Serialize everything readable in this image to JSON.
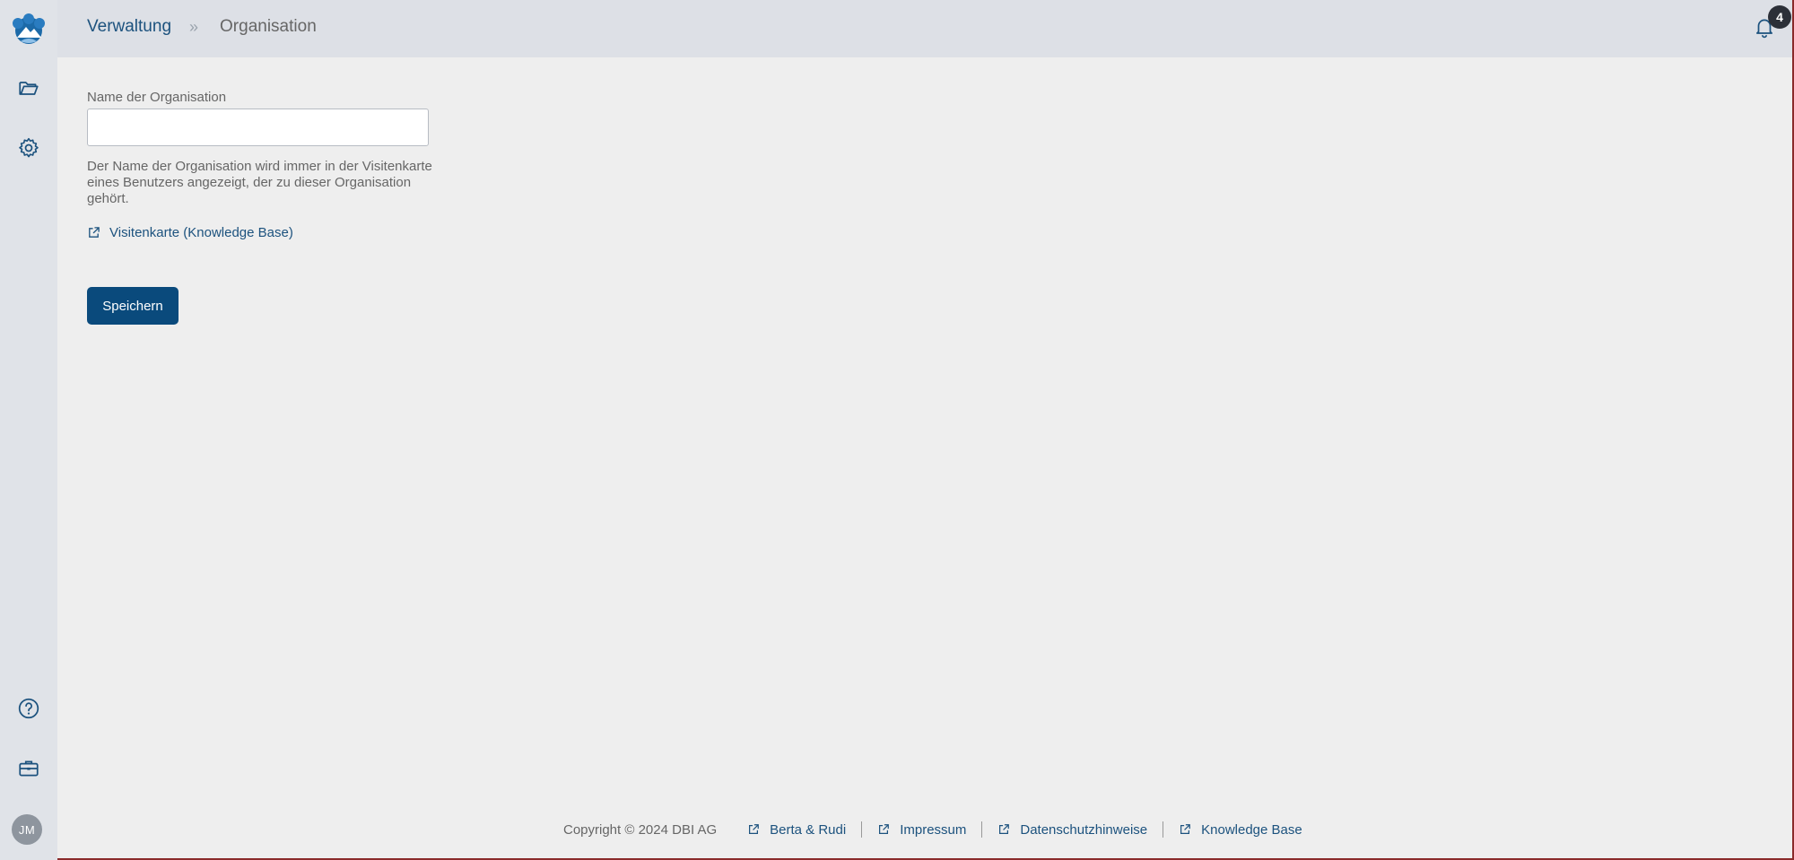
{
  "sidebar": {
    "avatar_initials": "JM",
    "items": [
      {
        "name": "folder-icon"
      },
      {
        "name": "gear-icon"
      },
      {
        "name": "help-icon"
      },
      {
        "name": "briefcase-icon"
      }
    ]
  },
  "header": {
    "breadcrumb": {
      "parent": "Verwaltung",
      "separator": "»",
      "current": "Organisation"
    },
    "notification_count": "4"
  },
  "form": {
    "label": "Name der Organisation",
    "value": "",
    "placeholder": "",
    "help_text": "Der Name der Organisation wird immer in der Visitenkarte eines Benutzers angezeigt, der zu dieser Organisation gehört.",
    "kb_link": "Visitenkarte (Knowledge Base)",
    "save_label": "Speichern"
  },
  "footer": {
    "copyright": "Copyright © 2024 DBI AG",
    "links": [
      "Berta & Rudi",
      "Impressum",
      "Datenschutzhinweise",
      "Knowledge Base"
    ]
  },
  "colors": {
    "accent": "#0a4a7c",
    "link": "#1c527e",
    "sidebar_bg": "#e0e3e8",
    "content_bg": "#eeeeee"
  }
}
